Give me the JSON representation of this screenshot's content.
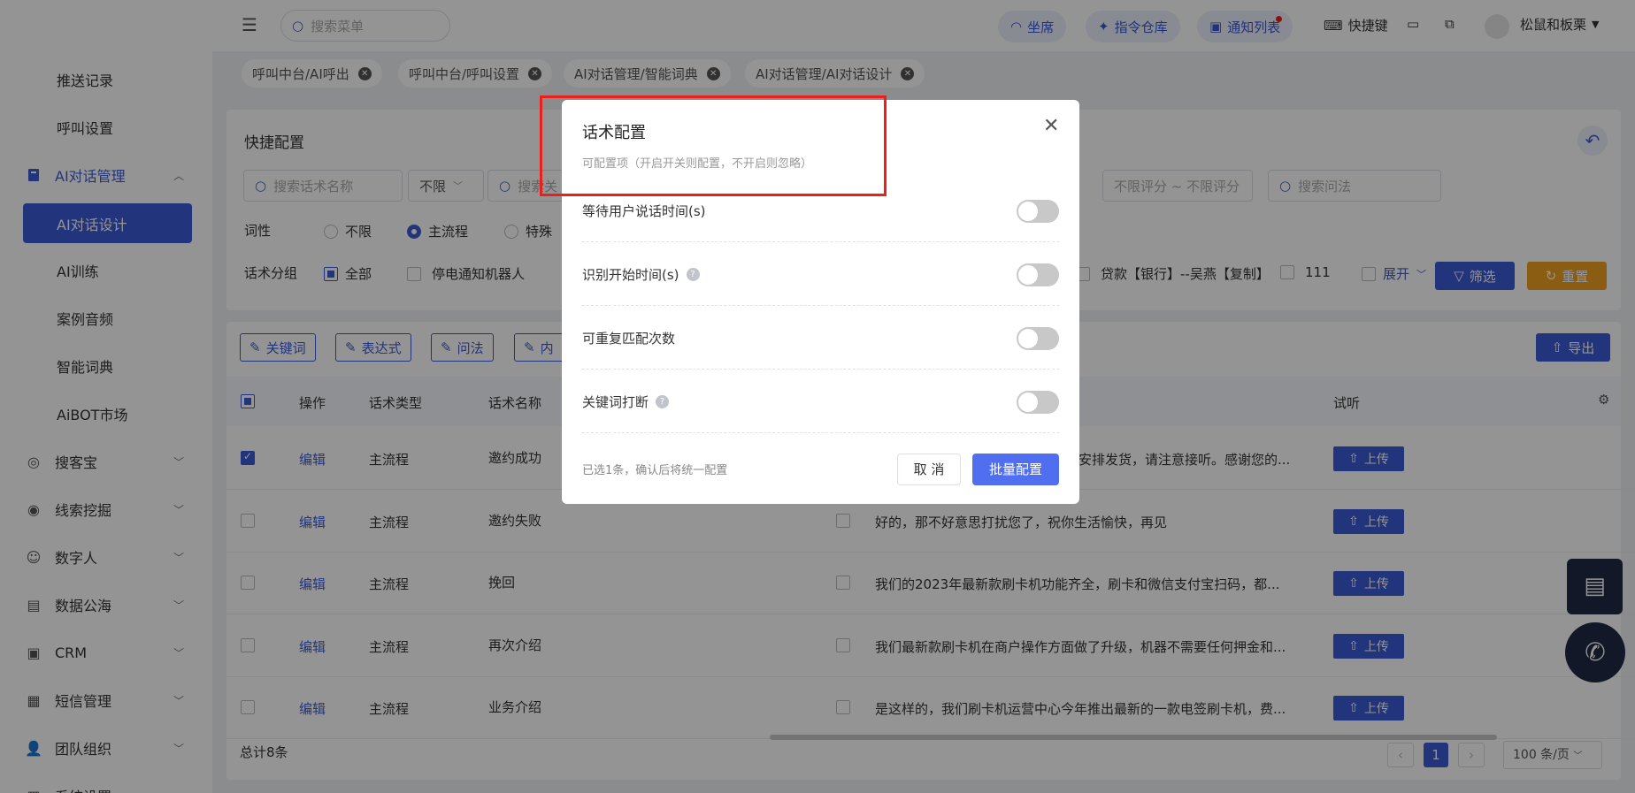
{
  "sidebar": {
    "items": [
      {
        "label": "推送记录"
      },
      {
        "label": "呼叫设置"
      },
      {
        "label": "AI对话管理"
      },
      {
        "label": "AI对话设计"
      },
      {
        "label": "AI训练"
      },
      {
        "label": "案例音频"
      },
      {
        "label": "智能词典"
      },
      {
        "label": "AiBOT市场"
      },
      {
        "label": "搜客宝"
      },
      {
        "label": "线索挖掘"
      },
      {
        "label": "数字人"
      },
      {
        "label": "数据公海"
      },
      {
        "label": "CRM"
      },
      {
        "label": "短信管理"
      },
      {
        "label": "团队组织"
      },
      {
        "label": "系统设置"
      }
    ]
  },
  "topbar": {
    "search_placeholder": "搜索菜单",
    "seat": "坐席",
    "command_repo": "指令仓库",
    "notify_list": "通知列表",
    "shortcut": "快捷键",
    "user": "松鼠和板栗"
  },
  "tabs": [
    {
      "label": "呼叫中台/AI呼出"
    },
    {
      "label": "呼叫中台/呼叫设置"
    },
    {
      "label": "AI对话管理/智能词典"
    },
    {
      "label": "AI对话管理/AI对话设计"
    }
  ],
  "filters": {
    "title": "快捷配置",
    "name_placeholder": "搜索话术名称",
    "limit_select": "不限",
    "keyword_placeholder": "搜索关",
    "score_range": "不限评分 ~ 不限评分",
    "question_placeholder": "搜索问法",
    "pos_label": "词性",
    "pos_options": [
      "不限",
      "主流程",
      "特殊"
    ],
    "group_label": "话术分组",
    "group_all": "全部",
    "group_opt1": "停电通知机器人",
    "group_opt2": "贷款【银行】--吴燕【复制】",
    "group_opt3": "111",
    "expand": "展开",
    "filter_btn": "筛选",
    "reset_btn": "重置"
  },
  "toolbar": {
    "keyword": "关键词",
    "expression": "表达式",
    "question": "问法",
    "inner": "内",
    "export": "导出"
  },
  "table": {
    "headers": {
      "op": "操作",
      "type": "话术类型",
      "name": "话术名称",
      "audition": "试听"
    },
    "rows": [
      {
        "op": "编辑",
        "type": "主流程",
        "name": "邀约成功",
        "text": "安排发货，请注意接听。感谢您的...",
        "upload": "上传"
      },
      {
        "op": "编辑",
        "type": "主流程",
        "name": "邀约失败",
        "text": "好的，那不好意思打扰您了，祝你生活愉快，再见",
        "upload": "上传"
      },
      {
        "op": "编辑",
        "type": "主流程",
        "name": "挽回",
        "text": "我们的2023年最新款刷卡机功能齐全，刷卡和微信支付宝扫码，都...",
        "upload": "上传"
      },
      {
        "op": "编辑",
        "type": "主流程",
        "name": "再次介绍",
        "text": "我们最新款刷卡机在商户操作方面做了升级，机器不需要任何押金和...",
        "upload": "上传"
      },
      {
        "op": "编辑",
        "type": "主流程",
        "name": "业务介绍",
        "text": "是这样的，我们刷卡机运营中心今年推出最新的一款电签刷卡机，费...",
        "upload": "上传"
      }
    ],
    "total": "总计8条",
    "page": "1",
    "page_size": "100 条/页"
  },
  "modal": {
    "title": "话术配置",
    "subtitle": "可配置项（开启开关则配置，不开启则忽略）",
    "settings": [
      {
        "label": "等待用户说话时间(s)"
      },
      {
        "label": "识别开始时间(s)"
      },
      {
        "label": "可重复匹配次数"
      },
      {
        "label": "关键词打断"
      }
    ],
    "footer_note": "已选1条，确认后将统一配置",
    "cancel": "取 消",
    "confirm": "批量配置"
  },
  "colors": {
    "primary": "#3c5ad6",
    "reset": "#f0a020",
    "highlight": "#e8211d"
  }
}
